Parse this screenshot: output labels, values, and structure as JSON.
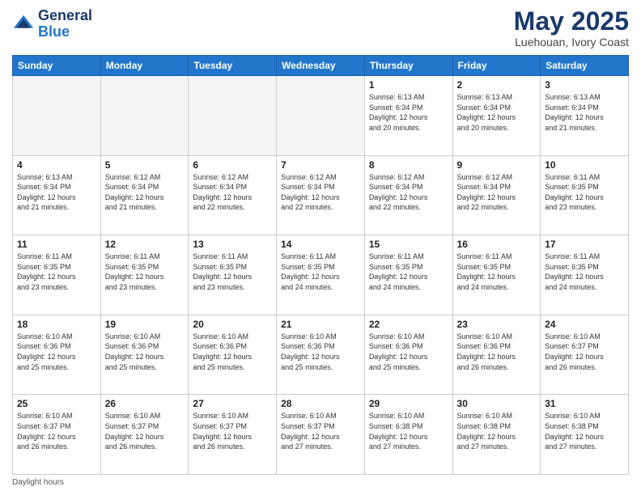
{
  "header": {
    "logo_line1": "General",
    "logo_line2": "Blue",
    "month_title": "May 2025",
    "subtitle": "Luehouan, Ivory Coast"
  },
  "weekdays": [
    "Sunday",
    "Monday",
    "Tuesday",
    "Wednesday",
    "Thursday",
    "Friday",
    "Saturday"
  ],
  "footer": {
    "daylight_label": "Daylight hours"
  },
  "weeks": [
    [
      {
        "day": "",
        "info": ""
      },
      {
        "day": "",
        "info": ""
      },
      {
        "day": "",
        "info": ""
      },
      {
        "day": "",
        "info": ""
      },
      {
        "day": "1",
        "info": "Sunrise: 6:13 AM\nSunset: 6:34 PM\nDaylight: 12 hours\nand 20 minutes."
      },
      {
        "day": "2",
        "info": "Sunrise: 6:13 AM\nSunset: 6:34 PM\nDaylight: 12 hours\nand 20 minutes."
      },
      {
        "day": "3",
        "info": "Sunrise: 6:13 AM\nSunset: 6:34 PM\nDaylight: 12 hours\nand 21 minutes."
      }
    ],
    [
      {
        "day": "4",
        "info": "Sunrise: 6:13 AM\nSunset: 6:34 PM\nDaylight: 12 hours\nand 21 minutes."
      },
      {
        "day": "5",
        "info": "Sunrise: 6:12 AM\nSunset: 6:34 PM\nDaylight: 12 hours\nand 21 minutes."
      },
      {
        "day": "6",
        "info": "Sunrise: 6:12 AM\nSunset: 6:34 PM\nDaylight: 12 hours\nand 22 minutes."
      },
      {
        "day": "7",
        "info": "Sunrise: 6:12 AM\nSunset: 6:34 PM\nDaylight: 12 hours\nand 22 minutes."
      },
      {
        "day": "8",
        "info": "Sunrise: 6:12 AM\nSunset: 6:34 PM\nDaylight: 12 hours\nand 22 minutes."
      },
      {
        "day": "9",
        "info": "Sunrise: 6:12 AM\nSunset: 6:34 PM\nDaylight: 12 hours\nand 22 minutes."
      },
      {
        "day": "10",
        "info": "Sunrise: 6:11 AM\nSunset: 6:35 PM\nDaylight: 12 hours\nand 23 minutes."
      }
    ],
    [
      {
        "day": "11",
        "info": "Sunrise: 6:11 AM\nSunset: 6:35 PM\nDaylight: 12 hours\nand 23 minutes."
      },
      {
        "day": "12",
        "info": "Sunrise: 6:11 AM\nSunset: 6:35 PM\nDaylight: 12 hours\nand 23 minutes."
      },
      {
        "day": "13",
        "info": "Sunrise: 6:11 AM\nSunset: 6:35 PM\nDaylight: 12 hours\nand 23 minutes."
      },
      {
        "day": "14",
        "info": "Sunrise: 6:11 AM\nSunset: 6:35 PM\nDaylight: 12 hours\nand 24 minutes."
      },
      {
        "day": "15",
        "info": "Sunrise: 6:11 AM\nSunset: 6:35 PM\nDaylight: 12 hours\nand 24 minutes."
      },
      {
        "day": "16",
        "info": "Sunrise: 6:11 AM\nSunset: 6:35 PM\nDaylight: 12 hours\nand 24 minutes."
      },
      {
        "day": "17",
        "info": "Sunrise: 6:11 AM\nSunset: 6:35 PM\nDaylight: 12 hours\nand 24 minutes."
      }
    ],
    [
      {
        "day": "18",
        "info": "Sunrise: 6:10 AM\nSunset: 6:36 PM\nDaylight: 12 hours\nand 25 minutes."
      },
      {
        "day": "19",
        "info": "Sunrise: 6:10 AM\nSunset: 6:36 PM\nDaylight: 12 hours\nand 25 minutes."
      },
      {
        "day": "20",
        "info": "Sunrise: 6:10 AM\nSunset: 6:36 PM\nDaylight: 12 hours\nand 25 minutes."
      },
      {
        "day": "21",
        "info": "Sunrise: 6:10 AM\nSunset: 6:36 PM\nDaylight: 12 hours\nand 25 minutes."
      },
      {
        "day": "22",
        "info": "Sunrise: 6:10 AM\nSunset: 6:36 PM\nDaylight: 12 hours\nand 25 minutes."
      },
      {
        "day": "23",
        "info": "Sunrise: 6:10 AM\nSunset: 6:36 PM\nDaylight: 12 hours\nand 26 minutes."
      },
      {
        "day": "24",
        "info": "Sunrise: 6:10 AM\nSunset: 6:37 PM\nDaylight: 12 hours\nand 26 minutes."
      }
    ],
    [
      {
        "day": "25",
        "info": "Sunrise: 6:10 AM\nSunset: 6:37 PM\nDaylight: 12 hours\nand 26 minutes."
      },
      {
        "day": "26",
        "info": "Sunrise: 6:10 AM\nSunset: 6:37 PM\nDaylight: 12 hours\nand 26 minutes."
      },
      {
        "day": "27",
        "info": "Sunrise: 6:10 AM\nSunset: 6:37 PM\nDaylight: 12 hours\nand 26 minutes."
      },
      {
        "day": "28",
        "info": "Sunrise: 6:10 AM\nSunset: 6:37 PM\nDaylight: 12 hours\nand 27 minutes."
      },
      {
        "day": "29",
        "info": "Sunrise: 6:10 AM\nSunset: 6:38 PM\nDaylight: 12 hours\nand 27 minutes."
      },
      {
        "day": "30",
        "info": "Sunrise: 6:10 AM\nSunset: 6:38 PM\nDaylight: 12 hours\nand 27 minutes."
      },
      {
        "day": "31",
        "info": "Sunrise: 6:10 AM\nSunset: 6:38 PM\nDaylight: 12 hours\nand 27 minutes."
      }
    ]
  ]
}
